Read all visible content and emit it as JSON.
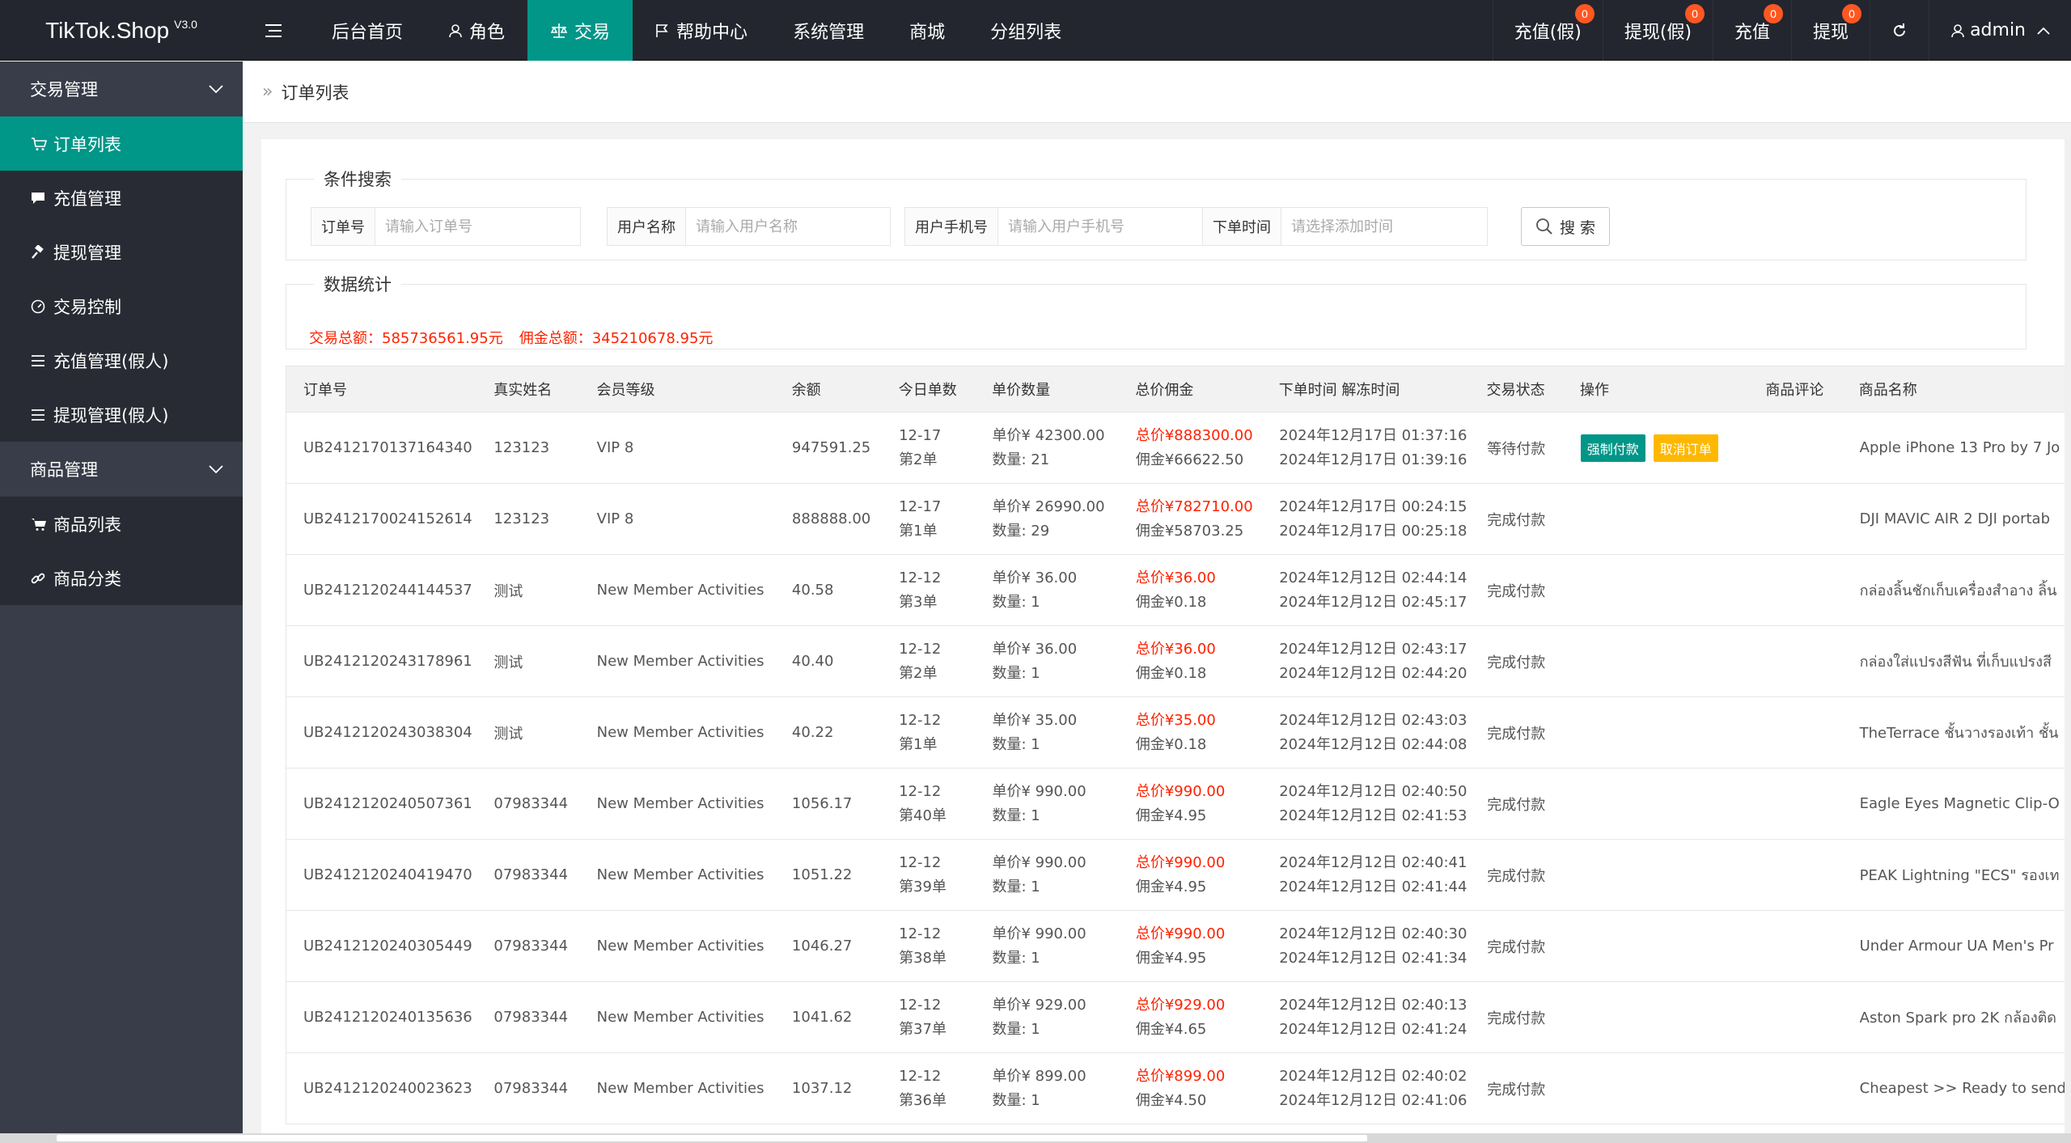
{
  "header": {
    "logo": "TikTok.Shop",
    "version": "V3.0",
    "nav": [
      {
        "label": "后台首页",
        "icon": "none"
      },
      {
        "label": "角色",
        "icon": "user-icon"
      },
      {
        "label": "交易",
        "icon": "scale-icon",
        "active": true
      },
      {
        "label": "帮助中心",
        "icon": "flag-icon"
      },
      {
        "label": "系统管理",
        "icon": "none"
      },
      {
        "label": "商城",
        "icon": "none"
      },
      {
        "label": "分组列表",
        "icon": "none"
      }
    ],
    "right": [
      {
        "label": "充值(假)",
        "badge": "0"
      },
      {
        "label": "提现(假)",
        "badge": "0"
      },
      {
        "label": "充值",
        "badge": "0"
      },
      {
        "label": "提现",
        "badge": "0"
      }
    ],
    "user": "admin"
  },
  "sidebar": {
    "groups": [
      {
        "label": "交易管理",
        "items": [
          {
            "label": "订单列表",
            "icon": "cart-icon",
            "active": true
          },
          {
            "label": "充值管理",
            "icon": "chat-icon"
          },
          {
            "label": "提现管理",
            "icon": "gavel-icon"
          },
          {
            "label": "交易控制",
            "icon": "gauge-icon"
          },
          {
            "label": "充值管理(假人)",
            "icon": "list-icon"
          },
          {
            "label": "提现管理(假人)",
            "icon": "list-icon"
          }
        ]
      },
      {
        "label": "商品管理",
        "items": [
          {
            "label": "商品列表",
            "icon": "cart-icon"
          },
          {
            "label": "商品分类",
            "icon": "link-icon"
          }
        ]
      }
    ]
  },
  "breadcrumb": "订单列表",
  "search": {
    "legend": "条件搜索",
    "fields": [
      {
        "label": "订单号",
        "placeholder": "请输入订单号"
      },
      {
        "label": "用户名称",
        "placeholder": "请输入用户名称"
      },
      {
        "label": "用户手机号",
        "placeholder": "请输入用户手机号"
      },
      {
        "label": "下单时间",
        "placeholder": "请选择添加时间"
      }
    ],
    "button": "搜 索"
  },
  "stats": {
    "legend": "数据统计",
    "total": "交易总额：585736561.95元",
    "commission": "佣金总额：345210678.95元"
  },
  "table": {
    "headers": [
      "订单号",
      "真实姓名",
      "会员等级",
      "余额",
      "今日单数",
      "单价数量",
      "总价佣金",
      "下单时间 解冻时间",
      "交易状态",
      "操作",
      "商品评论",
      "商品名称"
    ],
    "rows": [
      {
        "id": "UB2412170137164340",
        "name": "123123",
        "level": "VIP 8",
        "balance": "947591.25",
        "date": "12-17",
        "nth": "第2单",
        "price": "单价¥  42300.00",
        "qty": "数量:  21",
        "total": "总价¥888300.00",
        "comm": "佣金¥66622.50",
        "t1": "2024年12月17日 01:37:16",
        "t2": "2024年12月17日 01:39:16",
        "status": "等待付款",
        "op1": "强制付款",
        "op2": "取消订单",
        "product": "Apple iPhone 13 Pro by 7 Jo"
      },
      {
        "id": "UB2412170024152614",
        "name": "123123",
        "level": "VIP 8",
        "balance": "888888.00",
        "date": "12-17",
        "nth": "第1单",
        "price": "单价¥  26990.00",
        "qty": "数量:  29",
        "total": "总价¥782710.00",
        "comm": "佣金¥58703.25",
        "t1": "2024年12月17日 00:24:15",
        "t2": "2024年12月17日 00:25:18",
        "status": "完成付款",
        "op1": "",
        "op2": "",
        "product": "DJI MAVIC AIR 2 DJI portab"
      },
      {
        "id": "UB2412120244144537",
        "name": "测试",
        "level": "New Member Activities",
        "balance": "40.58",
        "date": "12-12",
        "nth": "第3单",
        "price": "单价¥  36.00",
        "qty": "数量:  1",
        "total": "总价¥36.00",
        "comm": "佣金¥0.18",
        "t1": "2024年12月12日 02:44:14",
        "t2": "2024年12月12日 02:45:17",
        "status": "完成付款",
        "op1": "",
        "op2": "",
        "product": "กล่องลิ้นชักเก็บเครื่องสำอาง ลิ้น"
      },
      {
        "id": "UB2412120243178961",
        "name": "测试",
        "level": "New Member Activities",
        "balance": "40.40",
        "date": "12-12",
        "nth": "第2单",
        "price": "单价¥  36.00",
        "qty": "数量:  1",
        "total": "总价¥36.00",
        "comm": "佣金¥0.18",
        "t1": "2024年12月12日 02:43:17",
        "t2": "2024年12月12日 02:44:20",
        "status": "完成付款",
        "op1": "",
        "op2": "",
        "product": "กล่องใส่แปรงสีฟัน ที่เก็บแปรงสี"
      },
      {
        "id": "UB2412120243038304",
        "name": "测试",
        "level": "New Member Activities",
        "balance": "40.22",
        "date": "12-12",
        "nth": "第1单",
        "price": "单价¥  35.00",
        "qty": "数量:  1",
        "total": "总价¥35.00",
        "comm": "佣金¥0.18",
        "t1": "2024年12月12日 02:43:03",
        "t2": "2024年12月12日 02:44:08",
        "status": "完成付款",
        "op1": "",
        "op2": "",
        "product": "TheTerrace ชั้นวางรองเท้า ชั้น"
      },
      {
        "id": "UB2412120240507361",
        "name": "07983344",
        "level": "New Member Activities",
        "balance": "1056.17",
        "date": "12-12",
        "nth": "第40单",
        "price": "单价¥  990.00",
        "qty": "数量:  1",
        "total": "总价¥990.00",
        "comm": "佣金¥4.95",
        "t1": "2024年12月12日 02:40:50",
        "t2": "2024年12月12日 02:41:53",
        "status": "完成付款",
        "op1": "",
        "op2": "",
        "product": "Eagle Eyes Magnetic Clip-O"
      },
      {
        "id": "UB2412120240419470",
        "name": "07983344",
        "level": "New Member Activities",
        "balance": "1051.22",
        "date": "12-12",
        "nth": "第39单",
        "price": "单价¥  990.00",
        "qty": "数量:  1",
        "total": "总价¥990.00",
        "comm": "佣金¥4.95",
        "t1": "2024年12月12日 02:40:41",
        "t2": "2024年12月12日 02:41:44",
        "status": "完成付款",
        "op1": "",
        "op2": "",
        "product": "PEAK Lightning \"ECS\" รองเท"
      },
      {
        "id": "UB2412120240305449",
        "name": "07983344",
        "level": "New Member Activities",
        "balance": "1046.27",
        "date": "12-12",
        "nth": "第38单",
        "price": "单价¥  990.00",
        "qty": "数量:  1",
        "total": "总价¥990.00",
        "comm": "佣金¥4.95",
        "t1": "2024年12月12日 02:40:30",
        "t2": "2024年12月12日 02:41:34",
        "status": "完成付款",
        "op1": "",
        "op2": "",
        "product": "Under Armour UA Men's Pr"
      },
      {
        "id": "UB2412120240135636",
        "name": "07983344",
        "level": "New Member Activities",
        "balance": "1041.62",
        "date": "12-12",
        "nth": "第37单",
        "price": "单价¥  929.00",
        "qty": "数量:  1",
        "total": "总价¥929.00",
        "comm": "佣金¥4.65",
        "t1": "2024年12月12日 02:40:13",
        "t2": "2024年12月12日 02:41:24",
        "status": "完成付款",
        "op1": "",
        "op2": "",
        "product": "Aston Spark pro 2K กล้องติด"
      },
      {
        "id": "UB2412120240023623",
        "name": "07983344",
        "level": "New Member Activities",
        "balance": "1037.12",
        "date": "12-12",
        "nth": "第36单",
        "price": "单价¥  899.00",
        "qty": "数量:  1",
        "total": "总价¥899.00",
        "comm": "佣金¥4.50",
        "t1": "2024年12月12日 02:40:02",
        "t2": "2024年12月12日 02:41:06",
        "status": "完成付款",
        "op1": "",
        "op2": "",
        "product": "Cheapest >> Ready to send"
      }
    ]
  }
}
